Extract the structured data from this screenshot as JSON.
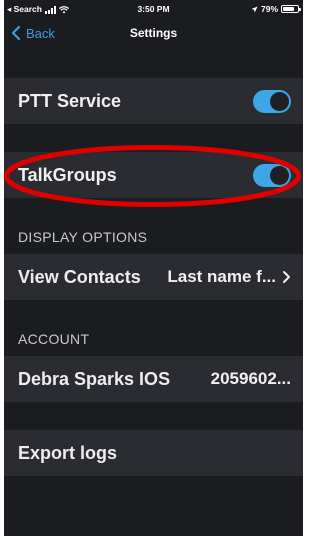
{
  "status_bar": {
    "carrier": "◂ Search",
    "time": "3:50 PM",
    "battery_pct": "79%",
    "battery_level": 0.79
  },
  "nav": {
    "back_label": "Back",
    "title": "Settings"
  },
  "rows": {
    "ptt_service": {
      "label": "PTT Service",
      "enabled": true
    },
    "talkgroups": {
      "label": "TalkGroups",
      "enabled": true
    }
  },
  "display_options": {
    "header": "DISPLAY OPTIONS",
    "view_contacts": {
      "label": "View Contacts",
      "value": "Last name f..."
    }
  },
  "account": {
    "header": "ACCOUNT",
    "name": "Debra Sparks IOS",
    "number": "2059602..."
  },
  "export_logs": {
    "label": "Export logs"
  },
  "colors": {
    "accent": "#3ea6e6",
    "background": "#1b1c20",
    "row_background": "#2a2c31",
    "annotation": "#e00000"
  }
}
